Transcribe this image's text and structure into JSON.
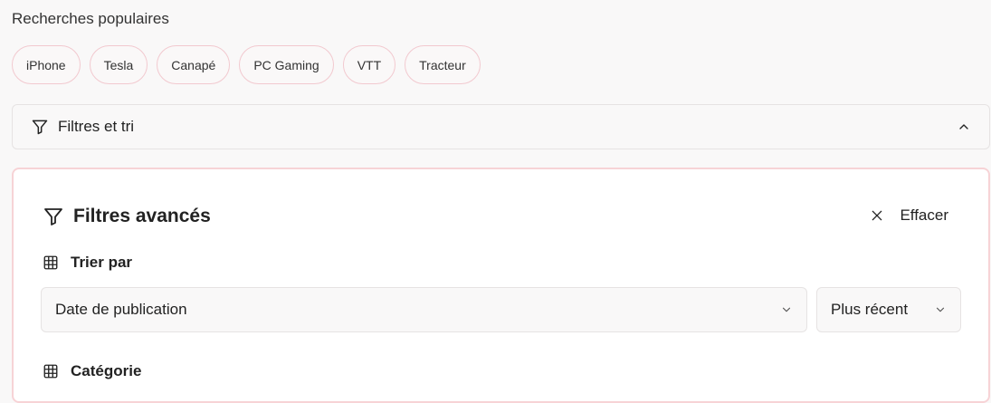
{
  "popular": {
    "title": "Recherches populaires",
    "chips": [
      "iPhone",
      "Tesla",
      "Canapé",
      "PC Gaming",
      "VTT",
      "Tracteur"
    ]
  },
  "filter_bar": {
    "label": "Filtres et tri",
    "icon": "filter-icon",
    "toggle_icon": "chevron-up-icon"
  },
  "advanced": {
    "title": "Filtres avancés",
    "clear_label": "Effacer",
    "sort": {
      "label": "Trier par",
      "field_value": "Date de publication",
      "order_value": "Plus récent"
    },
    "category": {
      "label": "Catégorie"
    }
  },
  "colors": {
    "chip_border": "#f2c9cf",
    "panel_border": "#f7d3d6",
    "background": "#f9f8f8"
  }
}
